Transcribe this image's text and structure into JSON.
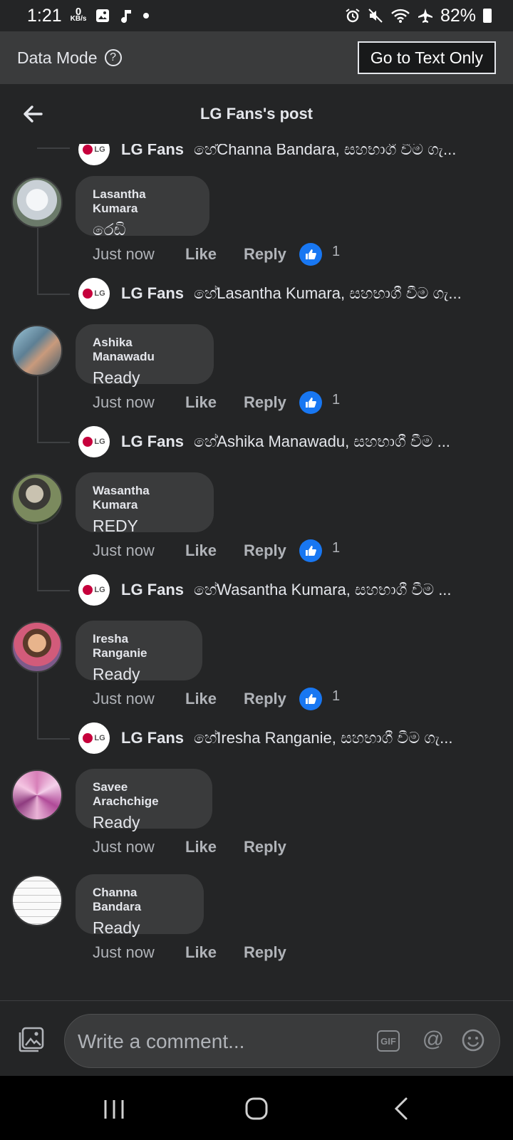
{
  "status_bar": {
    "time": "1:21",
    "net_speed_value": "0",
    "net_speed_unit": "KB/s",
    "battery": "82%"
  },
  "data_mode": {
    "label": "Data Mode",
    "text_only_button": "Go to Text Only"
  },
  "header": {
    "title": "LG Fans's post"
  },
  "partial_reply": {
    "name": "LG Fans",
    "text": "හේChanna Bandara, සහභාගී වීම ගැ..."
  },
  "comments": [
    {
      "name": "Lasantha Kumara",
      "text": "රෙඩි",
      "time": "Just now",
      "like": "Like",
      "reply": "Reply",
      "reaction_count": "1",
      "page_reply": {
        "name": "LG Fans",
        "text": "හේLasantha Kumara, සහභාගී වීම ගැ..."
      }
    },
    {
      "name": "Ashika Manawadu",
      "text": "Ready",
      "time": "Just now",
      "like": "Like",
      "reply": "Reply",
      "reaction_count": "1",
      "page_reply": {
        "name": "LG Fans",
        "text": "හේAshika Manawadu, සහභාගී වීම ..."
      }
    },
    {
      "name": "Wasantha Kumara",
      "text": "REDY",
      "time": "Just now",
      "like": "Like",
      "reply": "Reply",
      "reaction_count": "1",
      "page_reply": {
        "name": "LG Fans",
        "text": "හේWasantha Kumara, සහභාගී වීම ..."
      }
    },
    {
      "name": "Iresha Ranganie",
      "text": "Ready",
      "time": "Just now",
      "like": "Like",
      "reply": "Reply",
      "reaction_count": "1",
      "page_reply": {
        "name": "LG Fans",
        "text": "හේIresha Ranganie, සහභාගී වීම ගැ..."
      }
    },
    {
      "name": "Savee Arachchige",
      "text": "Ready",
      "time": "Just now",
      "like": "Like",
      "reply": "Reply"
    },
    {
      "name": "Channa Bandara",
      "text": "Ready",
      "time": "Just now",
      "like": "Like",
      "reply": "Reply"
    }
  ],
  "lg_logo_text": "LG",
  "composer": {
    "placeholder": "Write a comment...",
    "gif_label": "GIF"
  },
  "colors": {
    "background": "#242526",
    "bubble": "#3a3b3c",
    "like_blue": "#1877f2",
    "lg_red": "#c6003c"
  }
}
